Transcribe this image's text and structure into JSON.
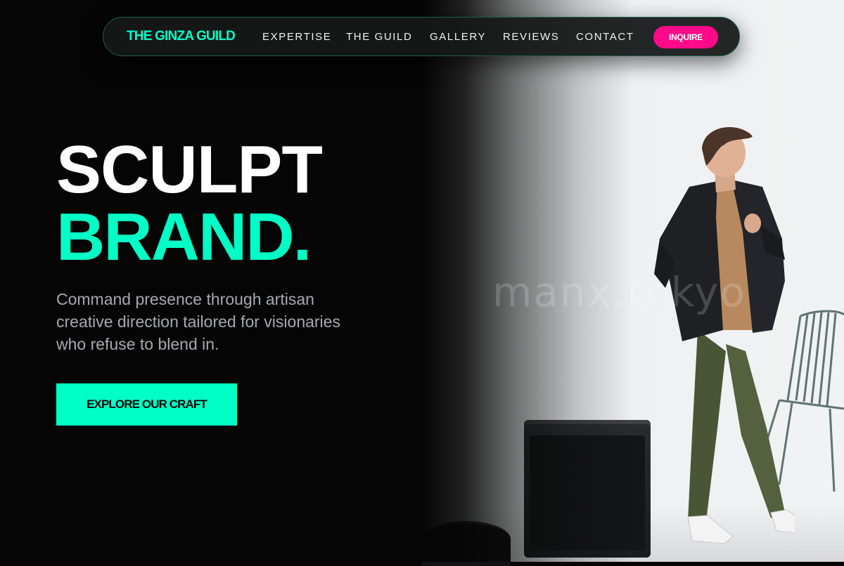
{
  "nav": {
    "brand": "THE GINZA GUILD",
    "links": [
      "EXPERTISE",
      "THE GUILD",
      "GALLERY",
      "REVIEWS",
      "CONTACT"
    ],
    "cta_label": "INQUIRE"
  },
  "hero": {
    "line1": "SCULPT",
    "line2": "BRAND.",
    "lede": "Command presence through artisan creative direction tailored for visionaries who refuse to blend in.",
    "cta_label": "EXPLORE OUR CRAFT"
  },
  "photo": {
    "watermark": "manx.tokyo"
  },
  "colors": {
    "background": "#050505",
    "accent_mint": "#00ffc6",
    "accent_pink": "#ff0a88",
    "text_muted": "#a7a9ad"
  }
}
